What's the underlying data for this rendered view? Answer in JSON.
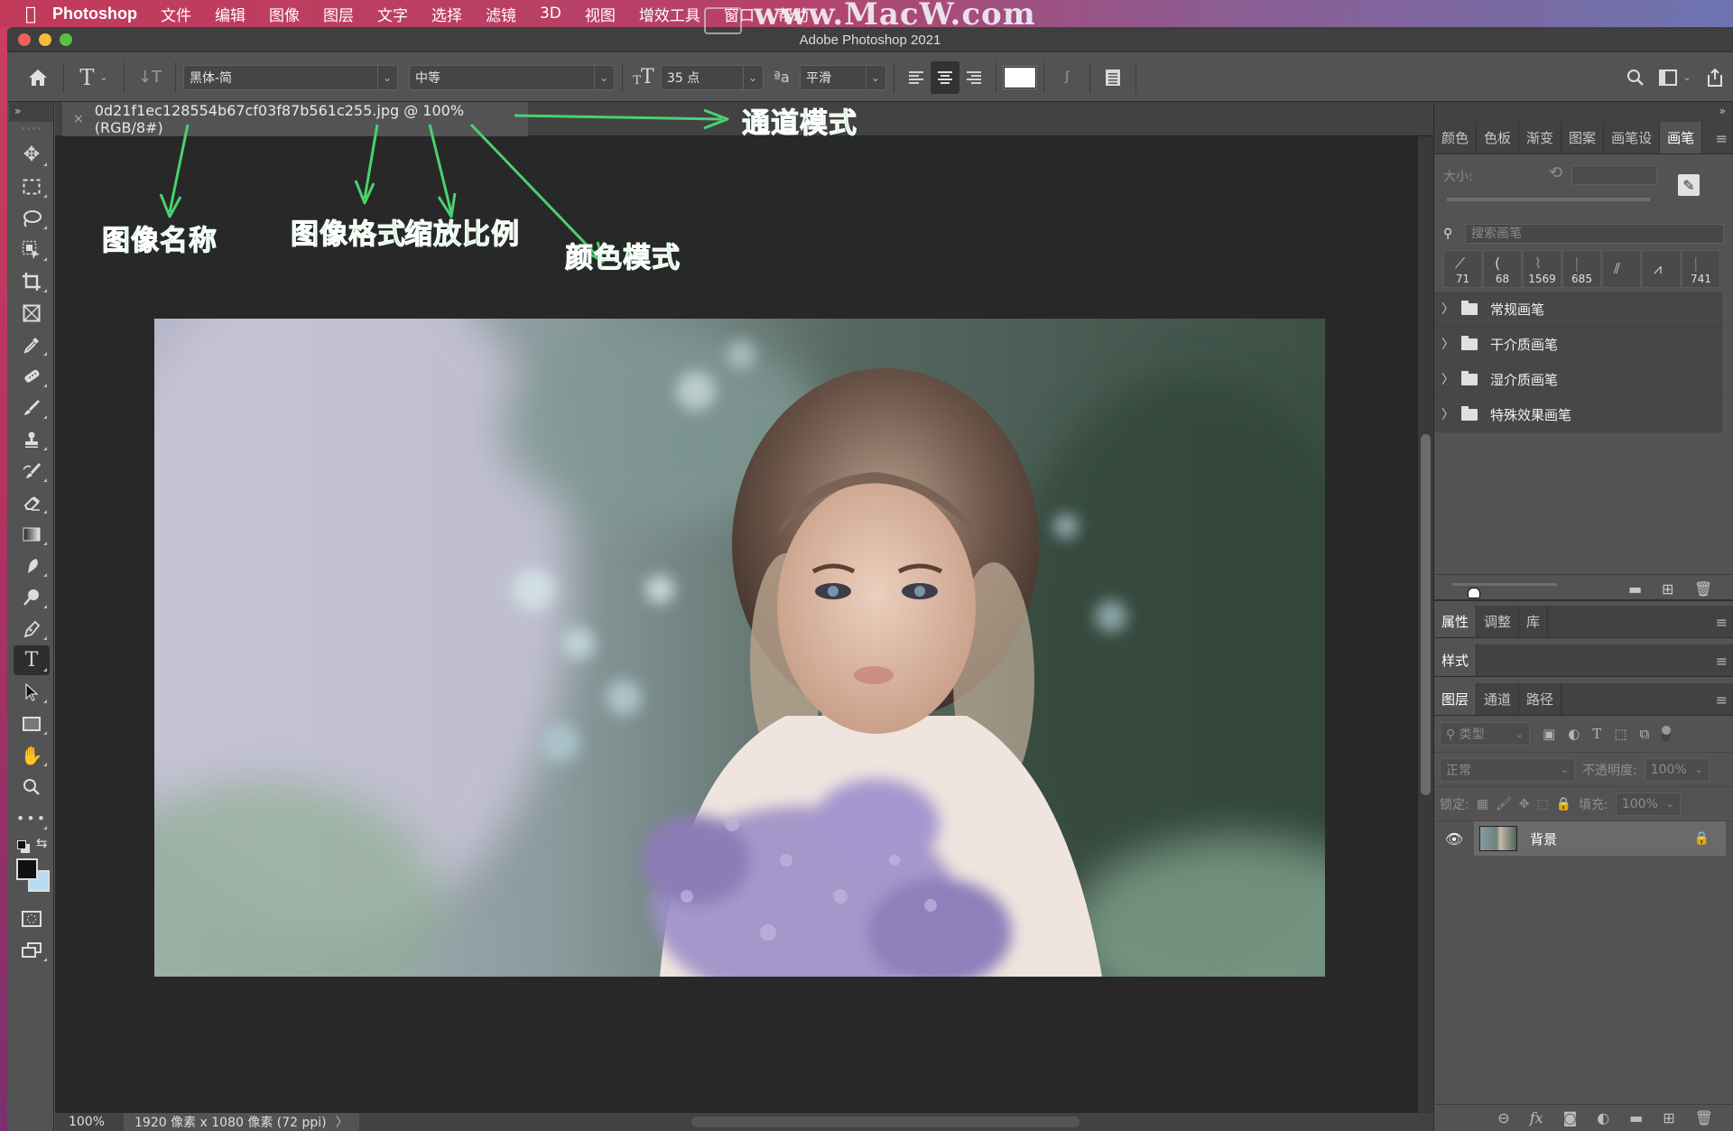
{
  "menubar": {
    "apple": "",
    "app_name": "Photoshop",
    "items": [
      "文件",
      "编辑",
      "图像",
      "图层",
      "文字",
      "选择",
      "滤镜",
      "3D",
      "视图",
      "增效工具",
      "窗口",
      "帮助"
    ]
  },
  "window": {
    "title": "Adobe Photoshop 2021",
    "watermark": "www.MacW.com"
  },
  "options_bar": {
    "font_family": "黑体-简",
    "font_style": "中等",
    "font_size": "35 点",
    "anti_alias_label": "ªa",
    "anti_alias": "平滑",
    "text_color": "#ffffff",
    "active_alignment": "center"
  },
  "tools": {
    "collapse_label": "»",
    "active": "type-tool",
    "foreground_color": "#111111",
    "background_color": "#b9dcf2"
  },
  "document": {
    "tab_close": "×",
    "tab_title": "0d21f1ec128554b67cf03f87b561c255.jpg @ 100%(RGB/8#)",
    "zoom": "100%",
    "info": "1920 像素 x 1080 像素 (72 ppi)",
    "info_more": "〉"
  },
  "annotations": {
    "image_name": "图像名称",
    "image_format": "图像格式",
    "zoom_ratio": "缩放比例",
    "color_mode": "颜色模式",
    "channel_mode": "通道模式",
    "color": "#49d26f"
  },
  "right_panel": {
    "collapse_label": "»",
    "top_tabs": [
      "颜色",
      "色板",
      "渐变",
      "图案",
      "画笔设",
      "画笔"
    ],
    "top_active": "画笔",
    "brush": {
      "size_label": "大小:",
      "search_placeholder": "搜索画笔",
      "presets": [
        "71",
        "68",
        "1569",
        "685",
        "",
        "",
        "741"
      ],
      "groups": [
        "常规画笔",
        "干介质画笔",
        "湿介质画笔",
        "特殊效果画笔"
      ]
    },
    "props_tabs": [
      "属性",
      "调整",
      "库"
    ],
    "style_tabs": [
      "样式"
    ],
    "layer_tabs": [
      "图层",
      "通道",
      "路径"
    ],
    "layers": {
      "filter_label": "类型",
      "blend_mode": "正常",
      "opacity_label": "不透明度:",
      "opacity": "100%",
      "lock_label": "锁定:",
      "fill_label": "填充:",
      "fill": "100%",
      "items": [
        {
          "name": "背景",
          "visible": true,
          "locked": true
        }
      ]
    }
  }
}
